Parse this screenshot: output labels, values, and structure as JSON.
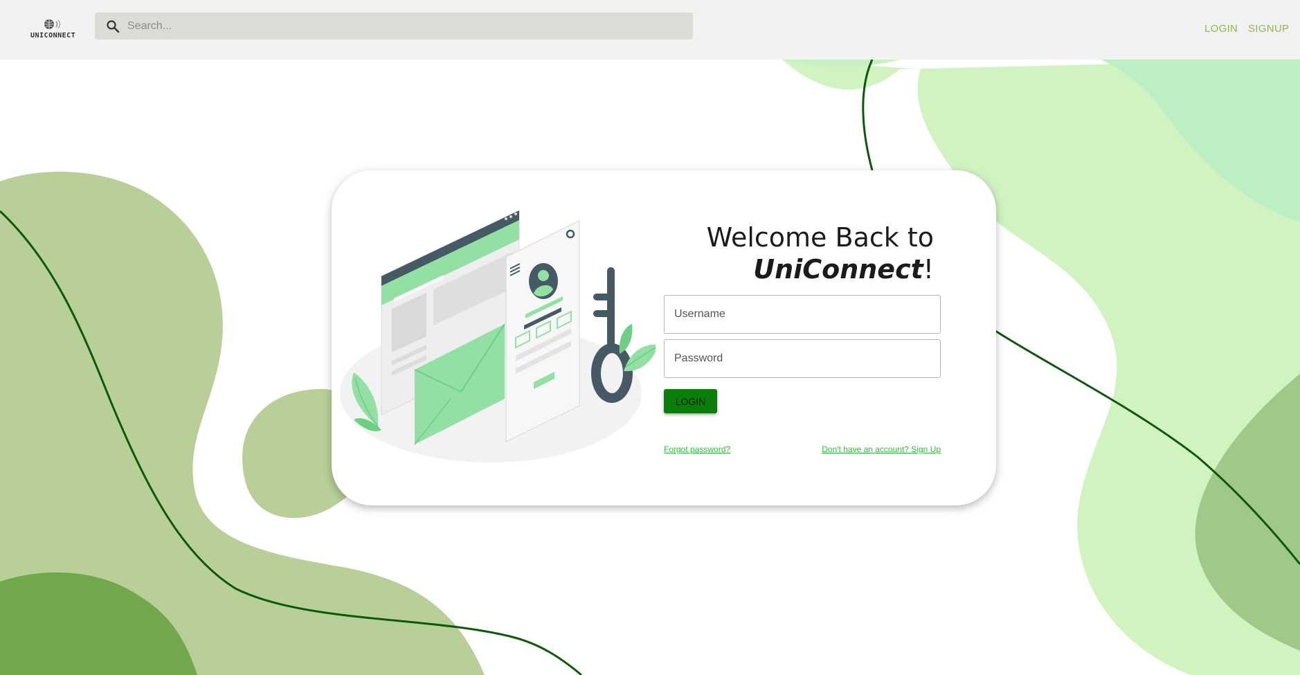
{
  "header": {
    "logo_text": "UNICONNECT",
    "search_placeholder": "Search...",
    "nav": {
      "login": "LOGIN",
      "signup": "SIGNUP"
    }
  },
  "login_card": {
    "heading_line1": "Welcome Back to",
    "brand_name": "UniConnect",
    "brand_suffix": "!",
    "username_placeholder": "Username",
    "password_placeholder": "Password",
    "login_button": "LOGIN",
    "forgot_password": "Forgot password?",
    "signup_prompt": "Don't have an account? Sign Up"
  },
  "icons": {
    "logo": "globe-wifi-icon",
    "search": "search-icon",
    "illustration": "login-security-illustration"
  },
  "colors": {
    "nav_link": "#8fb84c",
    "login_button": "#0b7d0b",
    "link": "#2bbf3a",
    "navbar_bg": "#f2f2f2",
    "search_bg": "#dadcd6",
    "blob_light": "#d0f3c0",
    "blob_mid": "#b8cf98",
    "blob_dark": "#72a84c",
    "curve": "#0a5a0a"
  }
}
